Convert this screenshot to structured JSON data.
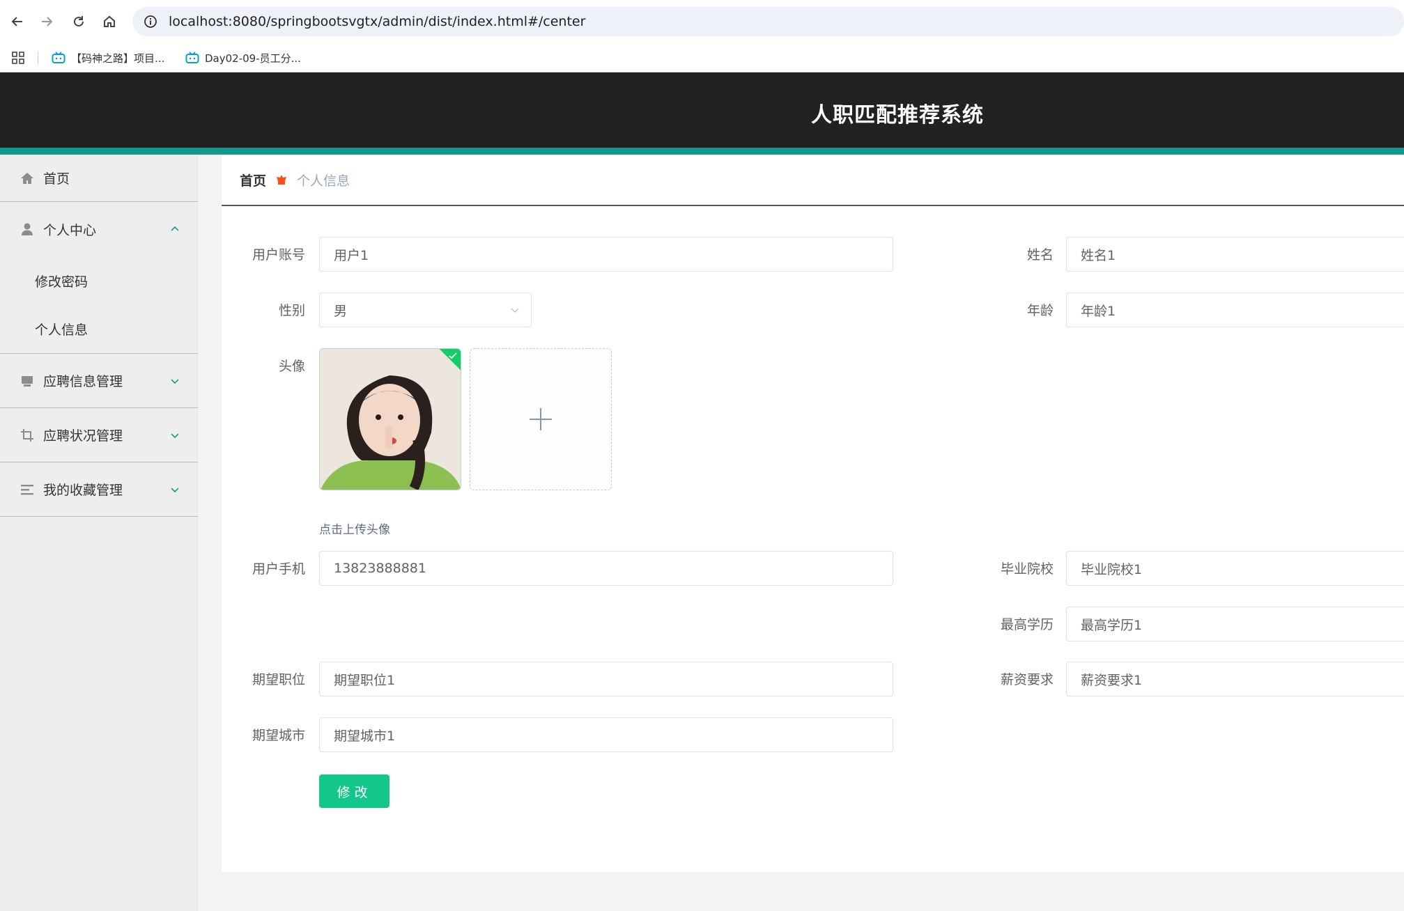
{
  "browser": {
    "url": "localhost:8080/springbootsvgtx/admin/dist/index.html#/center",
    "bookmarks": [
      {
        "label": "【码神之路】项目..."
      },
      {
        "label": "Day02-09-员工分..."
      }
    ]
  },
  "header": {
    "title": "人职匹配推荐系统",
    "accent_color": "#13998a"
  },
  "sidebar": {
    "items": [
      {
        "label": "首页",
        "icon": "home-icon"
      },
      {
        "label": "个人中心",
        "icon": "user-icon",
        "expanded": true
      },
      {
        "label": "应聘信息管理",
        "icon": "inbox-icon"
      },
      {
        "label": "应聘状况管理",
        "icon": "crop-icon"
      },
      {
        "label": "我的收藏管理",
        "icon": "list-icon"
      }
    ],
    "sub_items": [
      {
        "label": "修改密码"
      },
      {
        "label": "个人信息"
      }
    ]
  },
  "breadcrumb": {
    "home": "首页",
    "current": "个人信息"
  },
  "form": {
    "account": {
      "label": "用户账号",
      "value": "用户1"
    },
    "name": {
      "label": "姓名",
      "value": "姓名1"
    },
    "gender": {
      "label": "性别",
      "value": "男"
    },
    "age": {
      "label": "年龄",
      "value": "年龄1"
    },
    "avatar": {
      "label": "头像",
      "tip": "点击上传头像"
    },
    "phone": {
      "label": "用户手机",
      "value": "13823888881"
    },
    "school": {
      "label": "毕业院校",
      "value": "毕业院校1"
    },
    "education": {
      "label": "最高学历",
      "value": "最高学历1"
    },
    "position": {
      "label": "期望职位",
      "value": "期望职位1"
    },
    "salary": {
      "label": "薪资要求",
      "value": "薪资要求1"
    },
    "city": {
      "label": "期望城市",
      "value": "期望城市1"
    },
    "submit_label": "修改"
  }
}
